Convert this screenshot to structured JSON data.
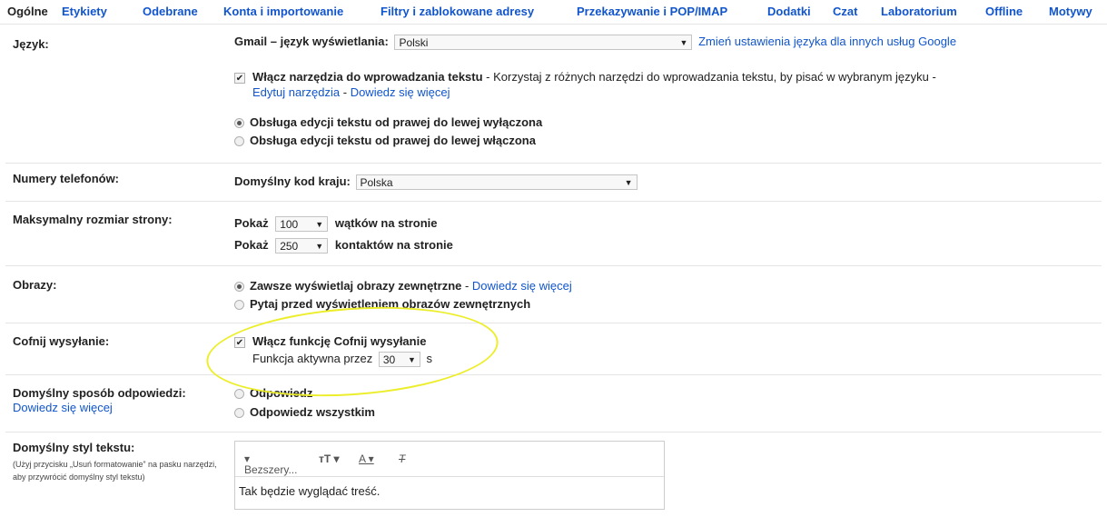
{
  "tabs": [
    "Ogólne",
    "Etykiety",
    "Odebrane",
    "Konta i importowanie",
    "Filtry i zablokowane adresy",
    "Przekazywanie i POP/IMAP",
    "Dodatki",
    "Czat",
    "Laboratorium",
    "Offline",
    "Motywy"
  ],
  "language": {
    "label": "Język:",
    "display_label": "Gmail – język wyświetlania:",
    "display_value": "Polski",
    "change_link": "Zmień ustawienia języka dla innych usług Google",
    "input_tools_label": "Włącz narzędzia do wprowadzania tekstu",
    "input_tools_desc": " - Korzystaj z różnych narzędzi do wprowadzania tekstu, by pisać w wybranym języku -",
    "edit_tools_link": "Edytuj narzędzia",
    "dash": " - ",
    "learn_more": "Dowiedz się więcej",
    "rtl_off": "Obsługa edycji tekstu od prawej do lewej wyłączona",
    "rtl_on": "Obsługa edycji tekstu od prawej do lewej włączona"
  },
  "phone": {
    "label": "Numery telefonów:",
    "country_label": "Domyślny kod kraju:",
    "country_value": "Polska"
  },
  "page_size": {
    "label": "Maksymalny rozmiar strony:",
    "show": "Pokaż",
    "threads_value": "100",
    "threads_suffix": "wątków na stronie",
    "contacts_value": "250",
    "contacts_suffix": "kontaktów na stronie"
  },
  "images": {
    "label": "Obrazy:",
    "always": "Zawsze wyświetlaj obrazy zewnętrzne",
    "dash": " - ",
    "learn_more": "Dowiedz się więcej",
    "ask": "Pytaj przed wyświetleniem obrazów zewnętrznych"
  },
  "undo": {
    "label": "Cofnij wysyłanie:",
    "enable": "Włącz funkcję Cofnij wysyłanie",
    "period_label": "Funkcja aktywna przez",
    "period_value": "30",
    "unit": "s"
  },
  "reply": {
    "label": "Domyślny sposób odpowiedzi:",
    "learn_more": "Dowiedz się więcej",
    "reply": "Odpowiedz",
    "reply_all": "Odpowiedz wszystkim"
  },
  "text_style": {
    "label": "Domyślny styl tekstu:",
    "hint": "(Użyj przycisku „Usuń formatowanie” na pasku narzędzi, aby przywrócić domyślny styl tekstu)",
    "font": "Bezszery...",
    "preview": "Tak będzie wyglądać treść."
  },
  "colors": {
    "link": "#1155cc",
    "highlight": "#ecee2c"
  }
}
